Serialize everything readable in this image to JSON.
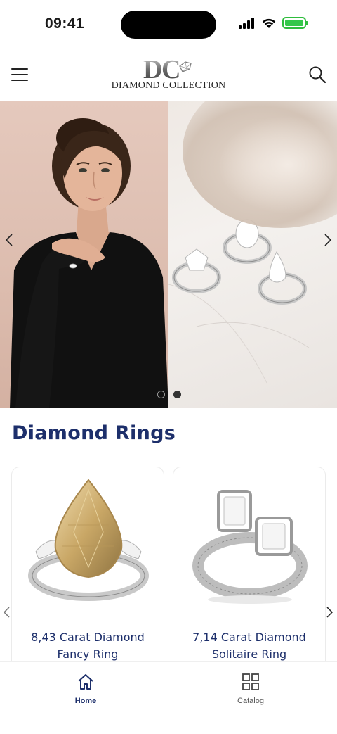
{
  "status_bar": {
    "time": "09:41",
    "signal_icon": "cellular-signal-icon",
    "wifi_icon": "wifi-icon",
    "battery_icon": "battery-charging-icon",
    "battery_color": "#34c74a"
  },
  "header": {
    "menu_icon": "hamburger-menu-icon",
    "logo_monogram": "DC",
    "logo_text": "DIAMOND COLLECTION",
    "search_icon": "search-icon"
  },
  "hero": {
    "slides_count": 2,
    "active_slide": 2,
    "prev_icon": "chevron-left-icon",
    "next_icon": "chevron-right-icon"
  },
  "section": {
    "title": "Diamond Rings",
    "title_color": "#1d2f6b"
  },
  "products": [
    {
      "name": "8,43 Carat Diamond Fancy Ring",
      "image_icon": "yellow-pear-diamond-ring-image"
    },
    {
      "name": "7,14 Carat Diamond Solitaire Ring",
      "image_icon": "toi-et-moi-diamond-ring-image"
    }
  ],
  "tabbar": {
    "tabs": [
      {
        "label": "Home",
        "icon": "home-icon",
        "active": true
      },
      {
        "label": "Catalog",
        "icon": "grid-icon",
        "active": false
      }
    ],
    "accent": "#1d2f6b"
  }
}
